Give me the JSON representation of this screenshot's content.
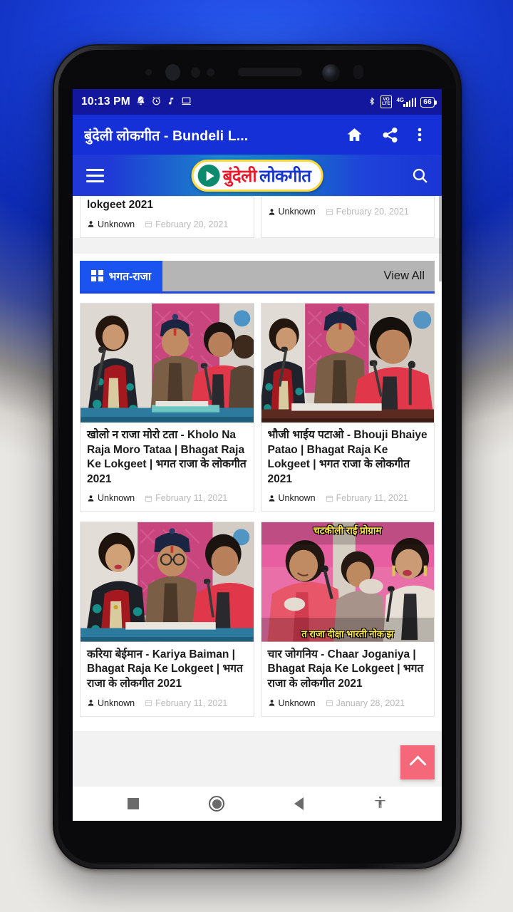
{
  "status_bar": {
    "time": "10:13 PM",
    "icons": [
      "mute-bell-icon",
      "alarm-icon",
      "music-note-icon",
      "screencast-icon"
    ],
    "right_icons": [
      "bluetooth-icon",
      "volte-icon",
      "4g-icon",
      "signal-icon"
    ],
    "volte_label": "VO\nLTE",
    "network_label": "4G",
    "battery_level": "66"
  },
  "app_bar": {
    "title": "बुंदेली लोकगीत - Bundeli L...",
    "home_icon": "home-icon",
    "share_icon": "share-icon",
    "menu_icon": "overflow-menu-icon"
  },
  "web_header": {
    "menu_icon": "hamburger-menu-icon",
    "logo_text_1": "बुंदेली",
    "logo_text_2": "लोकगीत",
    "logo_play_icon": "play-icon",
    "search_icon": "search-icon",
    "brand_red": "#e8192b",
    "brand_blue": "#1636d0",
    "brand_yellow": "#ffd83a"
  },
  "partial_cards": [
    {
      "title": "lokgeet 2021",
      "author": "Unknown",
      "date": "February 20, 2021"
    },
    {
      "title": "",
      "author": "Unknown",
      "date": "February 20, 2021"
    }
  ],
  "category": {
    "label": "भगत-राजा",
    "grid_icon": "grid-icon",
    "view_all": "View All",
    "accent": "#1b53f0"
  },
  "cards": [
    {
      "title": "खोलो न राजा मोरो टता - Kholo Na Raja Moro Tataa | Bhagat Raja Ke Lokgeet | भगत राजा के लोकगीत 2021",
      "author": "Unknown",
      "date": "February 11, 2021",
      "thumb_overlay_top": "",
      "thumb_overlay_bottom": ""
    },
    {
      "title": "भौजी भाईय पटाओ - Bhouji Bhaiye Patao | Bhagat Raja Ke Lokgeet | भगत राजा के लोकगीत 2021",
      "author": "Unknown",
      "date": "February 11, 2021",
      "thumb_overlay_top": "",
      "thumb_overlay_bottom": ""
    },
    {
      "title": "करिया बेईमान - Kariya Baiman | Bhagat Raja Ke Lokgeet | भगत राजा के लोकगीत 2021",
      "author": "Unknown",
      "date": "February 11, 2021",
      "thumb_overlay_top": "",
      "thumb_overlay_bottom": ""
    },
    {
      "title": "चार जोगनिय - Chaar Joganiya | Bhagat Raja Ke Lokgeet | भगत राजा के लोकगीत 2021",
      "author": "Unknown",
      "date": "January 28, 2021",
      "thumb_overlay_top": "चटकीली राई प्रोग्राम",
      "thumb_overlay_bottom": "त राजा दीक्षा भारती नोक झ"
    }
  ],
  "scroll_top": {
    "icon": "chevron-up-icon",
    "color": "#f4687a"
  },
  "nav_bar": {
    "recents_icon": "recents-square-icon",
    "home_icon": "home-circle-icon",
    "back_icon": "back-triangle-icon",
    "accessibility_icon": "accessibility-icon"
  },
  "author_icon": "person-icon",
  "date_icon": "calendar-icon"
}
